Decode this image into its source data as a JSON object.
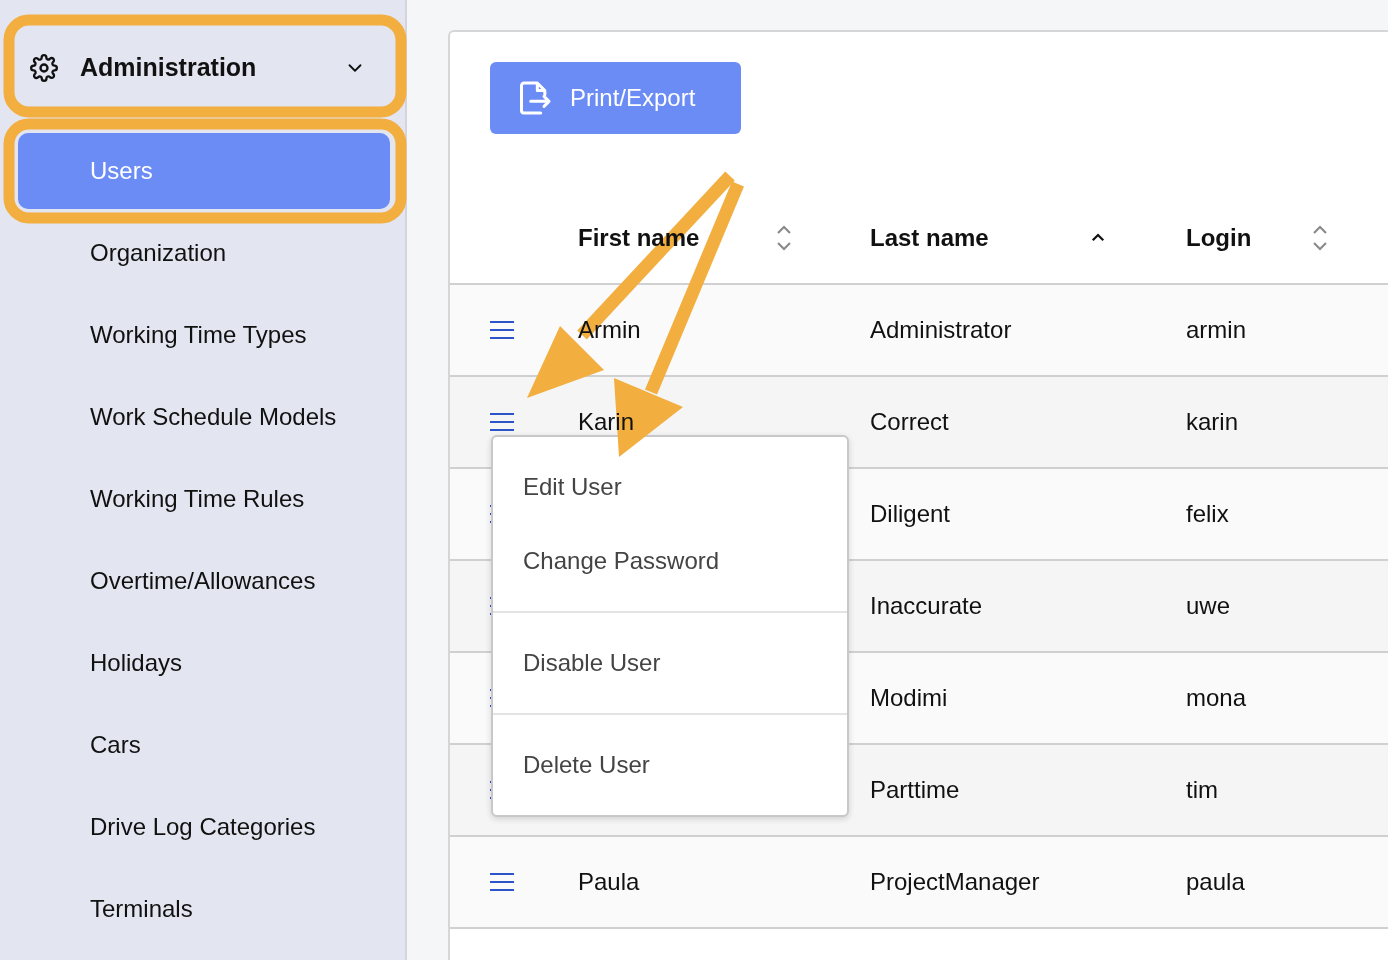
{
  "sidebar": {
    "section": {
      "label": "Administration",
      "expanded": true
    },
    "items": [
      {
        "label": "Users",
        "selected": true
      },
      {
        "label": "Organization",
        "selected": false
      },
      {
        "label": "Working Time Types",
        "selected": false
      },
      {
        "label": "Work Schedule Models",
        "selected": false
      },
      {
        "label": "Working Time Rules",
        "selected": false
      },
      {
        "label": "Overtime/Allowances",
        "selected": false
      },
      {
        "label": "Holidays",
        "selected": false
      },
      {
        "label": "Cars",
        "selected": false
      },
      {
        "label": "Drive Log Categories",
        "selected": false
      },
      {
        "label": "Terminals",
        "selected": false
      }
    ]
  },
  "toolbar": {
    "export_button": "Print/Export"
  },
  "table": {
    "columns": [
      {
        "label": "First name",
        "sorted": false
      },
      {
        "label": "Last name",
        "sorted": true
      },
      {
        "label": "Login",
        "sorted": false
      }
    ],
    "rows": [
      {
        "first_name": "Armin",
        "last_name": "Administrator",
        "login": "armin"
      },
      {
        "first_name": "Karin",
        "last_name": "Correct",
        "login": "karin"
      },
      {
        "last_name": "Diligent",
        "login": "felix"
      },
      {
        "last_name": "Inaccurate",
        "login": "uwe"
      },
      {
        "last_name": "Modimi",
        "login": "mona"
      },
      {
        "last_name": "Parttime",
        "login": "tim"
      },
      {
        "first_name": "Paula",
        "last_name": "ProjectManager",
        "login": "paula"
      }
    ]
  },
  "context_menu": {
    "groups": [
      [
        "Edit User",
        "Change Password"
      ],
      [
        "Disable User"
      ],
      [
        "Delete User"
      ]
    ]
  }
}
